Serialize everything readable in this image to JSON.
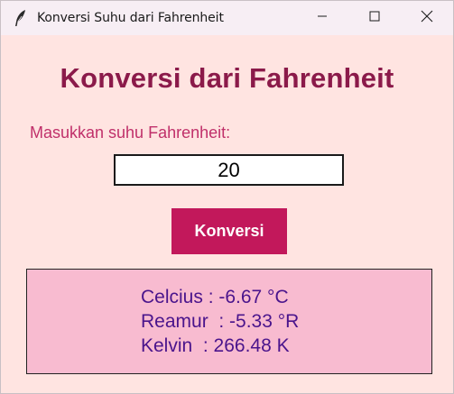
{
  "window": {
    "title": "Konversi Suhu dari Fahrenheit",
    "app_icon": "feather-icon",
    "controls": [
      "minimize-icon",
      "maximize-icon",
      "close-icon"
    ]
  },
  "main": {
    "heading": "Konversi dari Fahrenheit",
    "prompt_label": "Masukkan suhu Fahrenheit:",
    "input_value": "20",
    "convert_label": "Konversi",
    "results": {
      "celcius": "Celcius : -6.67 °C",
      "reamur": "Reamur  : -5.33 °R",
      "kelvin": "Kelvin  : 266.48 K"
    }
  },
  "colors": {
    "background": "#ffe4e1",
    "heading": "#8b1a4a",
    "prompt": "#c0306a",
    "button": "#c2185b",
    "result_box": "#f8bbd0",
    "result_text": "#4a148c"
  }
}
